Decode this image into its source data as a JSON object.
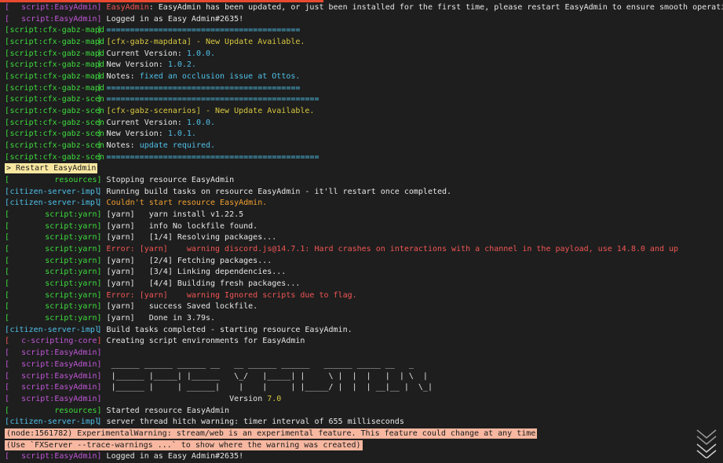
{
  "colors": {
    "background": "#1e1e1e",
    "text": "#e6e6e6",
    "cyan": "#4fc1e9",
    "green": "#3ddc3d",
    "magenta": "#c157d8",
    "red": "#f25555",
    "orange": "#f0a030",
    "yellow": "#d8c840",
    "highlight_yellow": "#f8e7a0",
    "highlight_salmon": "#f7b7a0",
    "highlight_text": "#1a1a1a"
  },
  "lines": [
    {
      "src": "script:EasyAdmin",
      "c": "magenta",
      "segs": [
        {
          "t": "EasyAdmin",
          "c": "red"
        },
        {
          "t": ": EasyAdmin has been updated, or just been installed for the first time, please restart EasyAdmin to ensure smooth operation."
        }
      ]
    },
    {
      "src": "script:EasyAdmin",
      "c": "magenta",
      "segs": [
        {
          "t": "Logged in as Easy Admin#2635!"
        }
      ]
    },
    {
      "src": "script:cfx-gabz-mapd",
      "c": "green",
      "segs": [
        {
          "t": "=========================================",
          "c": "cyan"
        }
      ]
    },
    {
      "src": "script:cfx-gabz-mapd",
      "c": "green",
      "segs": [
        {
          "t": "[cfx-gabz-mapdata] - New Update Available.",
          "c": "yellow"
        }
      ]
    },
    {
      "src": "script:cfx-gabz-mapd",
      "c": "green",
      "segs": [
        {
          "t": "Current Version: "
        },
        {
          "t": "1.0.0.",
          "c": "cyan"
        }
      ]
    },
    {
      "src": "script:cfx-gabz-mapd",
      "c": "green",
      "segs": [
        {
          "t": "New Version: "
        },
        {
          "t": "1.0.2.",
          "c": "cyan"
        }
      ]
    },
    {
      "src": "script:cfx-gabz-mapd",
      "c": "green",
      "segs": [
        {
          "t": "Notes: "
        },
        {
          "t": "fixed an occlusion issue at Ottos.",
          "c": "cyan"
        }
      ]
    },
    {
      "src": "script:cfx-gabz-mapd",
      "c": "green",
      "segs": [
        {
          "t": "=========================================",
          "c": "cyan"
        }
      ]
    },
    {
      "src": "script:cfx-gabz-scen",
      "c": "green",
      "segs": [
        {
          "t": "=============================================",
          "c": "cyan"
        }
      ]
    },
    {
      "src": "script:cfx-gabz-scen",
      "c": "green",
      "segs": [
        {
          "t": "[cfx-gabz-scenarios] - New Update Available.",
          "c": "yellow"
        }
      ]
    },
    {
      "src": "script:cfx-gabz-scen",
      "c": "green",
      "segs": [
        {
          "t": "Current Version: "
        },
        {
          "t": "1.0.0.",
          "c": "cyan"
        }
      ]
    },
    {
      "src": "script:cfx-gabz-scen",
      "c": "green",
      "segs": [
        {
          "t": "New Version: "
        },
        {
          "t": "1.0.1.",
          "c": "cyan"
        }
      ]
    },
    {
      "src": "script:cfx-gabz-scen",
      "c": "green",
      "segs": [
        {
          "t": "Notes: "
        },
        {
          "t": "update required.",
          "c": "cyan"
        }
      ]
    },
    {
      "src": "script:cfx-gabz-scen",
      "c": "green",
      "segs": [
        {
          "t": "=============================================",
          "c": "cyan"
        }
      ]
    },
    {
      "raw": "> Restart EasyAdmin",
      "hl": "yellow"
    },
    {
      "src": "resources",
      "c": "green",
      "segs": [
        {
          "t": "Stopping resource EasyAdmin"
        }
      ]
    },
    {
      "src": "citizen-server-impl",
      "c": "cyan",
      "segs": [
        {
          "t": "Running build tasks on resource EasyAdmin - it'll restart once completed."
        }
      ]
    },
    {
      "src": "citizen-server-impl",
      "c": "cyan",
      "segs": [
        {
          "t": "Couldn't start resource EasyAdmin.",
          "c": "orange"
        }
      ]
    },
    {
      "src": "script:yarn",
      "c": "green",
      "segs": [
        {
          "t": "[yarn]   yarn install v1.22.5"
        }
      ]
    },
    {
      "src": "script:yarn",
      "c": "green",
      "segs": [
        {
          "t": "[yarn]   info No lockfile found."
        }
      ]
    },
    {
      "src": "script:yarn",
      "c": "green",
      "segs": [
        {
          "t": "[yarn]   [1/4] Resolving packages..."
        }
      ]
    },
    {
      "src": "script:yarn",
      "c": "green",
      "segs": [
        {
          "t": "Error: [yarn]    warning discord.js@14.7.1: Hard crashes on interactions with a channel in the payload, use 14.8.0 and up",
          "c": "red"
        }
      ]
    },
    {
      "src": "script:yarn",
      "c": "green",
      "segs": [
        {
          "t": "[yarn]   [2/4] Fetching packages..."
        }
      ]
    },
    {
      "src": "script:yarn",
      "c": "green",
      "segs": [
        {
          "t": "[yarn]   [3/4] Linking dependencies..."
        }
      ]
    },
    {
      "src": "script:yarn",
      "c": "green",
      "segs": [
        {
          "t": "[yarn]   [4/4] Building fresh packages..."
        }
      ]
    },
    {
      "src": "script:yarn",
      "c": "green",
      "segs": [
        {
          "t": "Error: [yarn]    warning Ignored scripts due to flag.",
          "c": "red"
        }
      ]
    },
    {
      "src": "script:yarn",
      "c": "green",
      "segs": [
        {
          "t": "[yarn]   success Saved lockfile."
        }
      ]
    },
    {
      "src": "script:yarn",
      "c": "green",
      "segs": [
        {
          "t": "[yarn]   Done in 3.79s."
        }
      ]
    },
    {
      "src": "citizen-server-impl",
      "c": "cyan",
      "segs": [
        {
          "t": "Build tasks completed - starting resource EasyAdmin."
        }
      ]
    },
    {
      "src": "c-scripting-core",
      "c": "magenta",
      "bracket": "red",
      "segs": [
        {
          "t": "Creating script environments for EasyAdmin"
        }
      ]
    },
    {
      "src": "script:EasyAdmin",
      "c": "magenta",
      "segs": []
    },
    {
      "src": "script:EasyAdmin",
      "c": "magenta",
      "segs": [
        {
          "t": " ______ ______ ______ __   __ ______ ______   ______ _____ __   _"
        }
      ]
    },
    {
      "src": "script:EasyAdmin",
      "c": "magenta",
      "segs": [
        {
          "t": " |______ |_____| |______   \\_/   |_____| |     \\ |  |  |   |  | \\  |"
        }
      ]
    },
    {
      "src": "script:EasyAdmin",
      "c": "magenta",
      "segs": [
        {
          "t": " |______ |     | ______|    |    |     | |_____/ |  |  | __|__ |  \\_|"
        }
      ]
    },
    {
      "src": "script:EasyAdmin",
      "c": "magenta",
      "segs": [
        {
          "t": "                          Version "
        },
        {
          "t": "7.0",
          "c": "yellow"
        }
      ]
    },
    {
      "src": "resources",
      "c": "green",
      "segs": [
        {
          "t": "Started resource EasyAdmin"
        }
      ]
    },
    {
      "src": "citizen-server-impl",
      "c": "cyan",
      "segs": [
        {
          "t": "server thread hitch warning: timer interval of 655 milliseconds"
        }
      ]
    },
    {
      "raw": "(node:1561782) ExperimentalWarning: stream/web is an experimental feature. This feature could change at any time",
      "hl": "salmon"
    },
    {
      "raw": "(Use `FXServer --trace-warnings ...` to show where the warning was created)",
      "hl": "salmon"
    },
    {
      "src": "script:EasyAdmin",
      "c": "magenta",
      "segs": [
        {
          "t": "Logged in as Easy Admin#2635!"
        }
      ]
    }
  ],
  "scroll_button": {
    "icon": "double-chevron-down-icon"
  }
}
